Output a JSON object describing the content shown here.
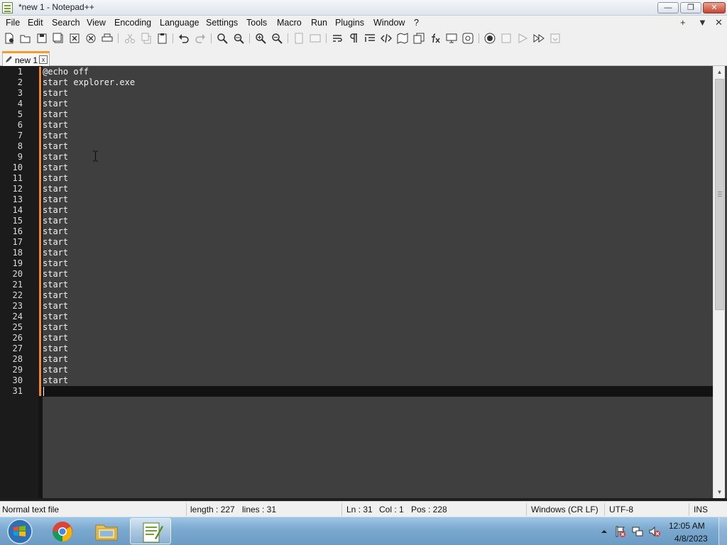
{
  "window": {
    "title": "*new 1 - Notepad++",
    "minimize_glyph": "—",
    "maximize_glyph": "❐",
    "close_glyph": "✕"
  },
  "menu": {
    "items": [
      "File",
      "Edit",
      "Search",
      "View",
      "Encoding",
      "Language",
      "Settings",
      "Tools",
      "Macro",
      "Run",
      "Plugins",
      "Window",
      "?"
    ],
    "right_items": [
      "+",
      "▼",
      "✕"
    ]
  },
  "toolbar": {
    "icons": [
      "new-file-icon",
      "open-file-icon",
      "save-icon",
      "save-all-icon",
      "close-icon",
      "close-all-icon",
      "print-icon",
      "cut-icon",
      "copy-icon",
      "paste-icon",
      "undo-icon",
      "redo-icon",
      "find-icon",
      "replace-icon",
      "zoom-in-icon",
      "zoom-out-icon",
      "sync-vertical-icon",
      "sync-horizontal-icon",
      "word-wrap-icon",
      "show-all-chars-icon",
      "indent-guide-icon",
      "xml-tag-icon",
      "document-map-icon",
      "document-list-icon",
      "function-list-icon",
      "monitoring-icon",
      "folder-as-workspace-icon",
      "record-macro-icon",
      "stop-macro-icon",
      "play-macro-icon",
      "run-macro-multiple-icon",
      "save-macro-icon"
    ]
  },
  "tab": {
    "label": "new 1",
    "close_glyph": "x",
    "accent_color": "#fa9b28"
  },
  "editor": {
    "lines": [
      "@echo off",
      "start explorer.exe",
      "start",
      "start",
      "start",
      "start",
      "start",
      "start",
      "start",
      "start",
      "start",
      "start",
      "start",
      "start",
      "start",
      "start",
      "start",
      "start",
      "start",
      "start",
      "start",
      "start",
      "start",
      "start",
      "start",
      "start",
      "start",
      "start",
      "start",
      "start",
      ""
    ],
    "background_color": "#3f3f3f",
    "gutter_color": "#1b1b1b",
    "change_marker_color": "#f08a2b"
  },
  "status": {
    "file_type": "Normal text file",
    "length": "length : 227",
    "lines": "lines : 31",
    "ln": "Ln : 31",
    "col": "Col : 1",
    "pos": "Pos : 228",
    "eol": "Windows (CR LF)",
    "encoding": "UTF-8",
    "mode": "INS"
  },
  "taskbar": {
    "apps": [
      "start-orb-icon",
      "chrome-icon",
      "file-explorer-icon",
      "notepad-plus-plus-icon"
    ],
    "tray_icons": [
      "show-hidden-icons-icon",
      "action-center-icon",
      "network-icon",
      "volume-muted-icon"
    ],
    "time": "12:05 AM",
    "date": "4/8/2023"
  }
}
